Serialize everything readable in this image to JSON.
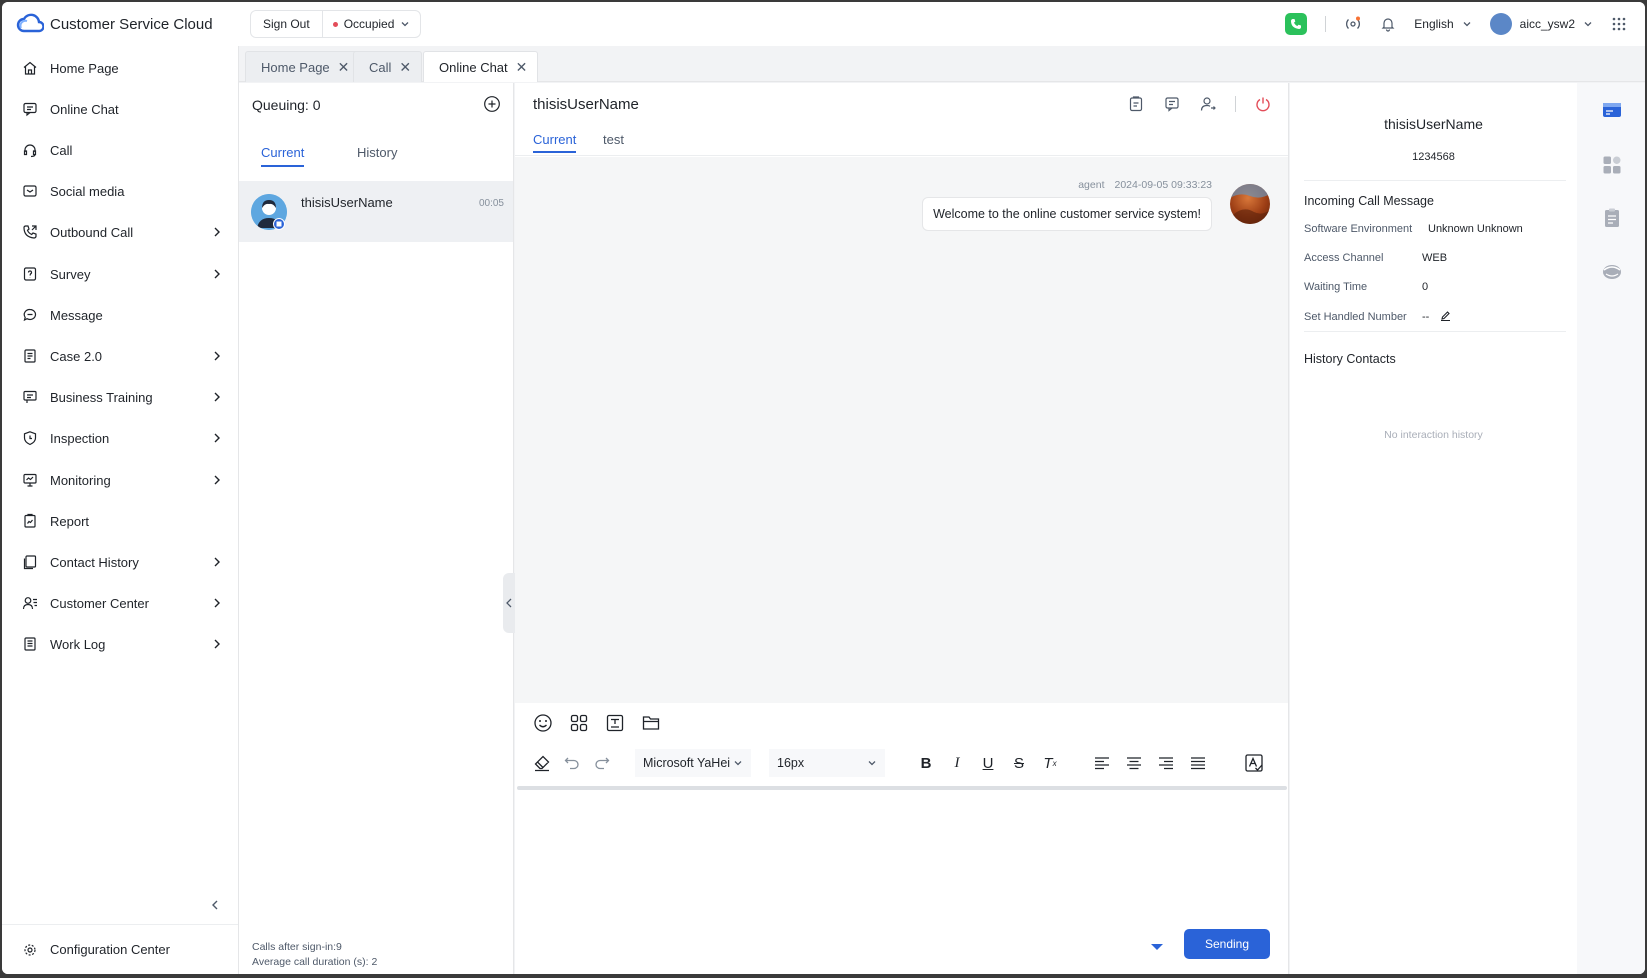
{
  "header": {
    "app_title": "Customer Service Cloud",
    "sign_out": "Sign Out",
    "status": "Occupied",
    "language": "English",
    "username": "aicc_ysw2"
  },
  "sidebar": {
    "items": [
      {
        "label": "Home Page",
        "icon": "home-icon",
        "expandable": false
      },
      {
        "label": "Online Chat",
        "icon": "chat-icon",
        "expandable": false
      },
      {
        "label": "Call",
        "icon": "headset-icon",
        "expandable": false
      },
      {
        "label": "Social media",
        "icon": "social-icon",
        "expandable": false
      },
      {
        "label": "Outbound Call",
        "icon": "outbound-call-icon",
        "expandable": true
      },
      {
        "label": "Survey",
        "icon": "survey-icon",
        "expandable": true
      },
      {
        "label": "Message",
        "icon": "message-icon",
        "expandable": false
      },
      {
        "label": "Case 2.0",
        "icon": "case-icon",
        "expandable": true
      },
      {
        "label": "Business Training",
        "icon": "training-icon",
        "expandable": true
      },
      {
        "label": "Inspection",
        "icon": "shield-icon",
        "expandable": true
      },
      {
        "label": "Monitoring",
        "icon": "monitor-icon",
        "expandable": true
      },
      {
        "label": "Report",
        "icon": "report-icon",
        "expandable": false
      },
      {
        "label": "Contact History",
        "icon": "history-icon",
        "expandable": true
      },
      {
        "label": "Customer Center",
        "icon": "customer-icon",
        "expandable": true
      },
      {
        "label": "Work Log",
        "icon": "worklog-icon",
        "expandable": true
      }
    ],
    "config": "Configuration Center"
  },
  "tabs": [
    {
      "label": "Home Page",
      "active": false
    },
    {
      "label": "Call",
      "active": false
    },
    {
      "label": "Online Chat",
      "active": true
    }
  ],
  "queue": {
    "title": "Queuing: 0",
    "tab_current": "Current",
    "tab_history": "History",
    "conversation": {
      "name": "thisisUserName",
      "time": "00:05"
    },
    "footer_calls": "Calls after sign-in:9",
    "footer_avg": "Average call duration (s): 2"
  },
  "chat": {
    "title": "thisisUserName",
    "tab_current": "Current",
    "tab_test": "test",
    "message": {
      "sender": "agent",
      "timestamp": "2024-09-05 09:33:23",
      "text": "Welcome to the online customer service system!"
    },
    "font_family": "Microsoft YaHei",
    "font_size": "16px",
    "send_label": "Sending"
  },
  "info": {
    "name": "thisisUserName",
    "number": "1234568",
    "section_incoming": "Incoming Call Message",
    "rows": [
      {
        "label": "Software Environment",
        "value": "Unknown Unknown"
      },
      {
        "label": "Access Channel",
        "value": "WEB"
      },
      {
        "label": "Waiting Time",
        "value": "0"
      },
      {
        "label": "Set Handled Number",
        "value": "--"
      }
    ],
    "section_history": "History Contacts",
    "empty_history": "No interaction history"
  },
  "colors": {
    "accent": "#2a63d8",
    "status_red": "#e34d59",
    "phone_green": "#2bc15b"
  }
}
